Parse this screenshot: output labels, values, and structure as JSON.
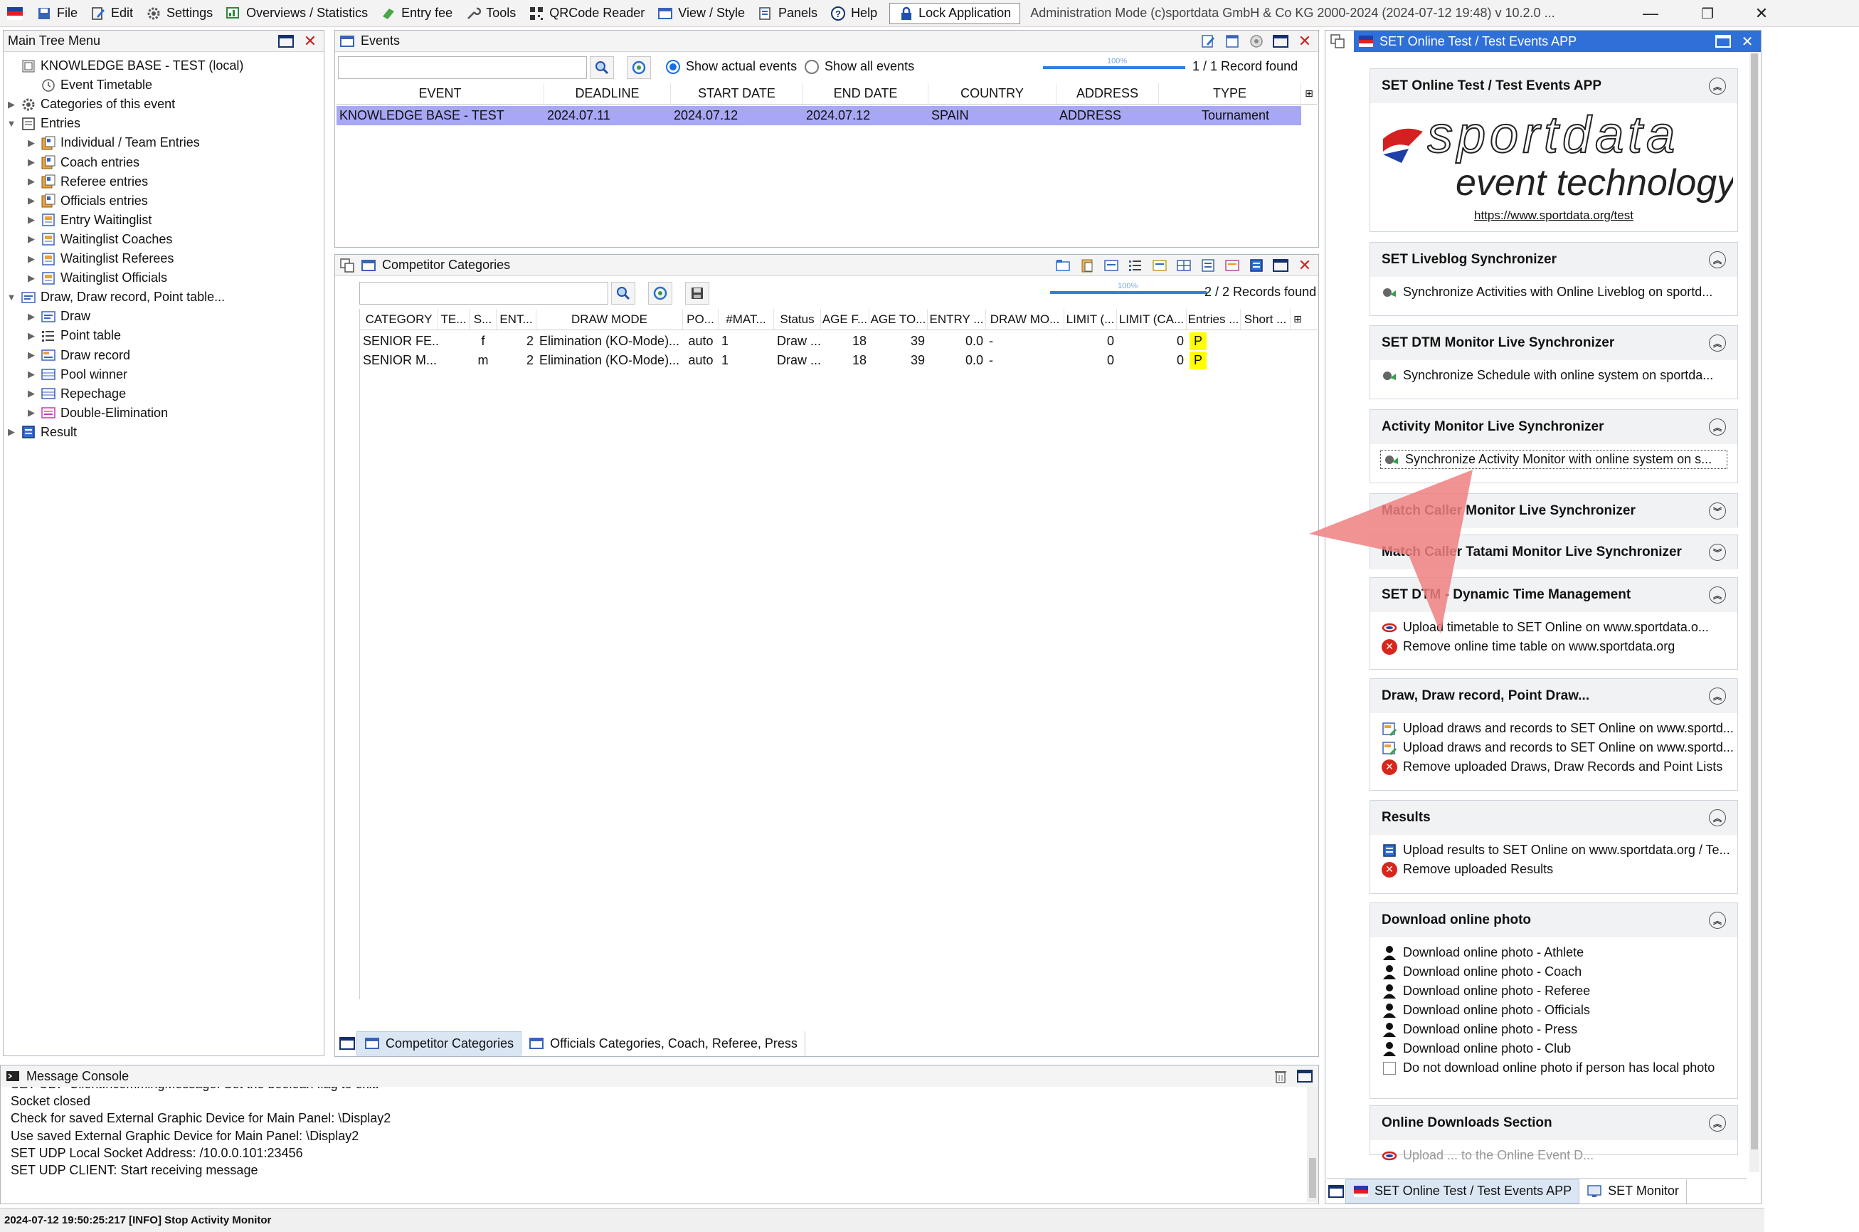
{
  "menubar": {
    "items": [
      {
        "label": "File",
        "icon": "file-icon"
      },
      {
        "label": "Edit",
        "icon": "edit-icon"
      },
      {
        "label": "Settings",
        "icon": "gear-icon"
      },
      {
        "label": "Overviews / Statistics",
        "icon": "statistics-icon"
      },
      {
        "label": "Entry fee",
        "icon": "money-icon"
      },
      {
        "label": "Tools",
        "icon": "wrench-icon"
      },
      {
        "label": "QRCode Reader",
        "icon": "qrcode-icon"
      },
      {
        "label": "View / Style",
        "icon": "view-icon"
      },
      {
        "label": "Panels",
        "icon": "panels-icon"
      },
      {
        "label": "Help",
        "icon": "help-icon"
      }
    ],
    "lock_label": "Lock Application",
    "title": "Administration Mode (c)sportdata GmbH & Co KG 2000-2024 (2024-07-12 19:48)  v 10.2.0 ..."
  },
  "tree": {
    "title": "Main Tree Menu",
    "items": [
      {
        "label": "KNOWLEDGE BASE - TEST (local)",
        "level": 0,
        "caret": "",
        "icon": "database-icon"
      },
      {
        "label": "Event Timetable",
        "level": 1,
        "caret": "",
        "icon": "clock-icon"
      },
      {
        "label": "Categories of this event",
        "level": 0,
        "caret": "▶",
        "icon": "gear-icon"
      },
      {
        "label": "Entries",
        "level": 0,
        "caret": "▼",
        "icon": "folder-icon"
      },
      {
        "label": "Individual / Team Entries",
        "level": 1,
        "caret": "▶",
        "icon": "entries-icon"
      },
      {
        "label": "Coach entries",
        "level": 1,
        "caret": "▶",
        "icon": "entries-icon"
      },
      {
        "label": "Referee entries",
        "level": 1,
        "caret": "▶",
        "icon": "entries-icon"
      },
      {
        "label": "Officials entries",
        "level": 1,
        "caret": "▶",
        "icon": "entries-icon"
      },
      {
        "label": "Entry Waitinglist",
        "level": 1,
        "caret": "▶",
        "icon": "waitinglist-icon"
      },
      {
        "label": "Waitinglist Coaches",
        "level": 1,
        "caret": "▶",
        "icon": "waitinglist-icon"
      },
      {
        "label": "Waitinglist Referees",
        "level": 1,
        "caret": "▶",
        "icon": "waitinglist-icon"
      },
      {
        "label": "Waitinglist Officials",
        "level": 1,
        "caret": "▶",
        "icon": "waitinglist-icon"
      },
      {
        "label": "Draw, Draw record, Point table...",
        "level": 0,
        "caret": "▼",
        "icon": "draw-icon"
      },
      {
        "label": "Draw",
        "level": 1,
        "caret": "▶",
        "icon": "draw-icon"
      },
      {
        "label": "Point table",
        "level": 1,
        "caret": "▶",
        "icon": "list-icon"
      },
      {
        "label": "Draw record",
        "level": 1,
        "caret": "▶",
        "icon": "record-icon"
      },
      {
        "label": "Pool winner",
        "level": 1,
        "caret": "▶",
        "icon": "table-icon"
      },
      {
        "label": "Repechage",
        "level": 1,
        "caret": "▶",
        "icon": "table-icon"
      },
      {
        "label": "Double-Elimination",
        "level": 1,
        "caret": "▶",
        "icon": "double-elim-icon"
      },
      {
        "label": "Result",
        "level": 0,
        "caret": "▶",
        "icon": "result-icon"
      }
    ]
  },
  "events": {
    "title": "Events",
    "search_value": "",
    "radio_actual": "Show actual events",
    "radio_all": "Show all events",
    "progress_label": "100%",
    "progress": 1.0,
    "record_count": "1 / 1 Record found",
    "columns": [
      "EVENT",
      "DEADLINE",
      "START DATE",
      "END DATE",
      "COUNTRY",
      "ADDRESS",
      "TYPE"
    ],
    "rows": [
      [
        "KNOWLEDGE BASE - TEST",
        "2024.07.11",
        "2024.07.12",
        "2024.07.12",
        "SPAIN",
        "ADDRESS",
        "Tournament"
      ]
    ]
  },
  "categories": {
    "title": "Competitor Categories",
    "search_value": "",
    "progress_label": "100%",
    "progress": 1.0,
    "record_count": "2 / 2 Records found",
    "columns": [
      "CATEGORY",
      "TE...",
      "S...",
      "ENT...",
      "DRAW MODE",
      "PO...",
      "#MAT...",
      "Status",
      "AGE F...",
      "AGE TO...",
      "ENTRY ...",
      "DRAW MO...",
      "LIMIT (...",
      "LIMIT (CA...",
      "Entries ...",
      "Short ..."
    ],
    "rows": [
      [
        "SENIOR FE...",
        "",
        "f",
        "2",
        "Elimination (KO-Mode)...",
        "auto",
        "1",
        "Draw ...",
        "18",
        "39",
        "0.0",
        "-",
        "0",
        "0",
        "P",
        ""
      ],
      [
        "SENIOR M...",
        "",
        "m",
        "2",
        "Elimination (KO-Mode)...",
        "auto",
        "1",
        "Draw ...",
        "18",
        "39",
        "0.0",
        "-",
        "0",
        "0",
        "P",
        ""
      ]
    ],
    "tabs": [
      "Competitor Categories",
      "Officials Categories, Coach, Referee, Press"
    ]
  },
  "console": {
    "title": "Message Console",
    "lines": [
      "SET UDP ClientIncommingMessage: Set the boolean flag to exit.",
      "Socket closed",
      "Check for saved External Graphic Device for Main Panel: \\Display2",
      "Use saved External Graphic Device for Main Panel: \\Display2",
      "SET UDP Local Socket Address: /10.0.0.101:23456",
      "SET UDP CLIENT: Start receiving message"
    ]
  },
  "status": "2024-07-12 19:50:25:217 [INFO] Stop Activity Monitor",
  "app": {
    "title": "SET Online Test / Test Events APP",
    "logo": {
      "text_top": "sportdata",
      "text_bottom": "event technology",
      "link": "https://www.sportdata.org/test"
    },
    "sections": [
      {
        "title": "SET Online Test / Test Events APP",
        "chev": "up"
      },
      {
        "title": "SET Liveblog Synchronizer",
        "chev": "up",
        "items": [
          {
            "icon": "sync-icon",
            "label": "Synchronize Activities with Online Liveblog on sportd..."
          }
        ]
      },
      {
        "title": "SET DTM Monitor Live Synchronizer",
        "chev": "up",
        "items": [
          {
            "icon": "sync-icon",
            "label": "Synchronize Schedule with online system on sportda..."
          }
        ]
      },
      {
        "title": "Activity Monitor Live Synchronizer",
        "chev": "up",
        "items": [
          {
            "icon": "sync-icon",
            "label": "Synchronize Activity Monitor with online system on s..."
          }
        ]
      },
      {
        "title": "Match Caller Monitor Live Synchronizer",
        "chev": "down"
      },
      {
        "title": "Match Caller Tatami Monitor Live Synchronizer",
        "chev": "down"
      },
      {
        "title": "SET DTM - Dynamic Time Management",
        "chev": "up",
        "items": [
          {
            "icon": "sportdata-icon",
            "label": "Upload timetable to SET Online on www.sportdata.o..."
          },
          {
            "icon": "error-icon",
            "label": "Remove online time table on www.sportdata.org"
          }
        ]
      },
      {
        "title": "Draw, Draw record, Point Draw...",
        "chev": "up",
        "items": [
          {
            "icon": "upload-icon",
            "label": "Upload draws and records to SET Online on www.sportd..."
          },
          {
            "icon": "upload-icon",
            "label": "Upload draws and records to SET Online on www.sportd..."
          },
          {
            "icon": "error-icon",
            "label": "Remove uploaded Draws, Draw Records and Point Lists"
          }
        ]
      },
      {
        "title": "Results",
        "chev": "up",
        "items": [
          {
            "icon": "result-icon",
            "label": "Upload results to SET Online on www.sportdata.org / Te..."
          },
          {
            "icon": "error-icon",
            "label": "Remove uploaded Results"
          }
        ]
      },
      {
        "title": "Download online photo",
        "chev": "up",
        "items": [
          {
            "icon": "person-icon",
            "label": "Download online photo - Athlete"
          },
          {
            "icon": "person-icon",
            "label": "Download online photo - Coach"
          },
          {
            "icon": "person-icon",
            "label": "Download online photo - Referee"
          },
          {
            "icon": "person-icon",
            "label": "Download online photo - Officials"
          },
          {
            "icon": "person-icon",
            "label": "Download online photo - Press"
          },
          {
            "icon": "person-icon",
            "label": "Download online photo - Club"
          },
          {
            "icon": "checkbox",
            "label": "Do not download online photo if person has local photo"
          }
        ]
      },
      {
        "title": "Online Downloads Section",
        "chev": "up",
        "items": [
          {
            "icon": "sportdata-icon",
            "label": "Upload ... to the Online Event D..."
          }
        ]
      }
    ],
    "tabs": [
      "SET Online Test / Test Events APP",
      "SET Monitor"
    ]
  },
  "colors": {
    "selection": "#a7a7f5",
    "accent": "#2f7fe0",
    "error": "#d9261c",
    "highlight": "#ffff00",
    "arrow": "#f08080"
  }
}
